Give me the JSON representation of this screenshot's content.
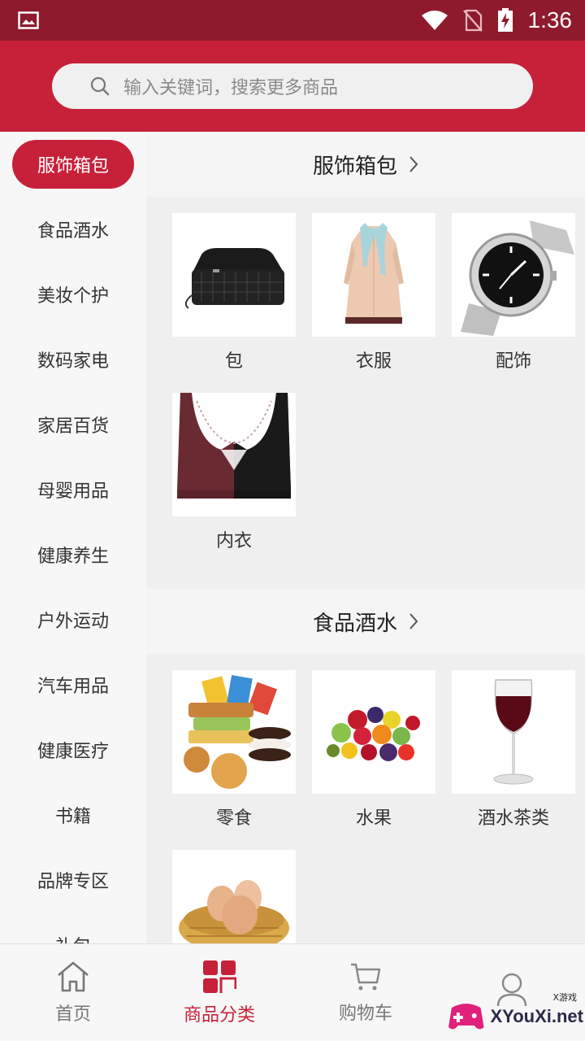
{
  "status_bar": {
    "time": "1:36"
  },
  "search": {
    "placeholder": "输入关键词，搜索更多商品"
  },
  "sidebar": {
    "items": [
      {
        "label": "服饰箱包",
        "active": true
      },
      {
        "label": "食品酒水"
      },
      {
        "label": "美妆个护"
      },
      {
        "label": "数码家电"
      },
      {
        "label": "家居百货"
      },
      {
        "label": "母婴用品"
      },
      {
        "label": "健康养生"
      },
      {
        "label": "户外运动"
      },
      {
        "label": "汽车用品"
      },
      {
        "label": "健康医疗"
      },
      {
        "label": "书籍"
      },
      {
        "label": "品牌专区"
      },
      {
        "label": "礼包"
      }
    ]
  },
  "sections": [
    {
      "title": "服饰箱包",
      "items": [
        {
          "label": "包",
          "image": "black-clutch-bag"
        },
        {
          "label": "衣服",
          "image": "beige-trench-coat"
        },
        {
          "label": "配饰",
          "image": "silver-wristwatch"
        },
        {
          "label": "内衣",
          "image": "lace-bra"
        }
      ]
    },
    {
      "title": "食品酒水",
      "items": [
        {
          "label": "零食",
          "image": "snacks-pile"
        },
        {
          "label": "水果",
          "image": "mixed-fruits"
        },
        {
          "label": "酒水茶类",
          "image": "red-wine-glass"
        },
        {
          "label": "",
          "image": "eggs-basket"
        }
      ]
    }
  ],
  "tabbar": {
    "tabs": [
      {
        "label": "首页",
        "icon": "home-icon"
      },
      {
        "label": "商品分类",
        "icon": "category-icon",
        "active": true
      },
      {
        "label": "购物车",
        "icon": "cart-icon"
      },
      {
        "label": "",
        "icon": "user-icon"
      }
    ]
  },
  "watermark": {
    "text": "XYouXi.net",
    "small": "X游戏"
  },
  "colors": {
    "brand": "#c7213a",
    "status_bar": "#8e1a2c"
  }
}
